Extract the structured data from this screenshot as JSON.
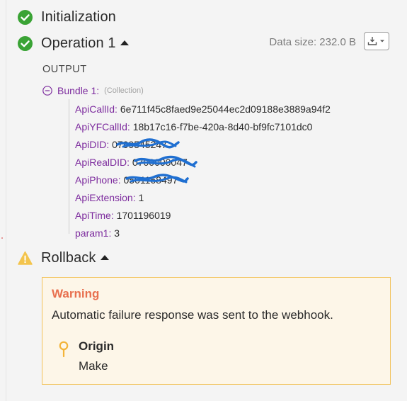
{
  "initialization": {
    "title": "Initialization",
    "status": "success"
  },
  "operation": {
    "title": "Operation 1",
    "data_size": "Data size: 232.0 B",
    "output_label": "OUTPUT",
    "bundle": {
      "label": "Bundle 1:",
      "type": "(Collection)",
      "items": [
        {
          "key": "ApiCallId:",
          "value": "6e711f45c8faed9e25044ec2d09188e3889a94f2",
          "redacted": false
        },
        {
          "key": "ApiYFCallId:",
          "value": "18b17c16-f7be-420a-8d40-bf9fc7101dc0",
          "redacted": false
        },
        {
          "key": "ApiDID:",
          "value": "0799545247",
          "redacted": true
        },
        {
          "key": "ApiRealDID:",
          "value": "0700000047",
          "redacted": true
        },
        {
          "key": "ApiPhone:",
          "value": "0501168497",
          "redacted": true
        },
        {
          "key": "ApiExtension:",
          "value": "1",
          "redacted": false
        },
        {
          "key": "ApiTime:",
          "value": "1701196019",
          "redacted": false
        },
        {
          "key": "param1:",
          "value": "3",
          "redacted": false
        }
      ]
    }
  },
  "rollback": {
    "title": "Rollback",
    "status": "warning",
    "warning": {
      "title": "Warning",
      "message": "Automatic failure response was sent to the webhook.",
      "origin_title": "Origin",
      "origin_value": "Make"
    }
  },
  "colors": {
    "success": "#3aa335",
    "warning_icon": "#f3c44d",
    "warning_title": "#e8704f",
    "key": "#7d2c9e",
    "redaction": "#1f6fd1"
  },
  "icons": {
    "success": "check-circle-icon",
    "warning": "warning-triangle-icon",
    "collapse": "minus-circle-icon",
    "download": "download-icon",
    "origin": "pin-icon"
  }
}
